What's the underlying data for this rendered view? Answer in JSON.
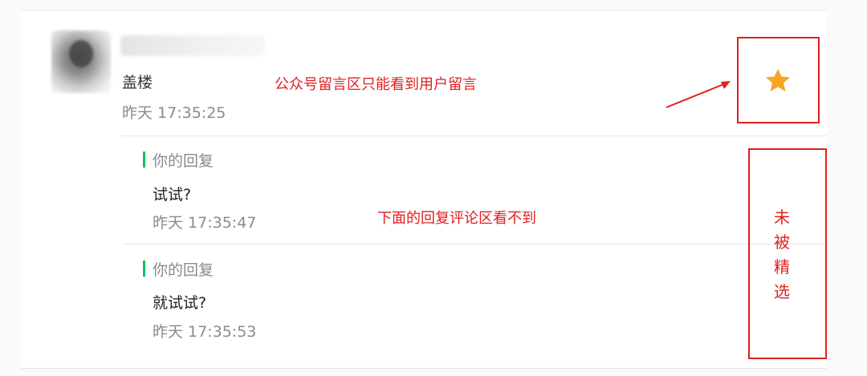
{
  "comment": {
    "text": "盖楼",
    "time": "昨天 17:35:25"
  },
  "replies": [
    {
      "label": "你的回复",
      "text": "试试?",
      "time": "昨天 17:35:47"
    },
    {
      "label": "你的回复",
      "text": "就试试?",
      "time": "昨天 17:35:53"
    }
  ],
  "annotations": {
    "top_note": "公众号留言区只能看到用户留言",
    "middle_note": "下面的回复评论区看不到",
    "side_note_chars": [
      "未",
      "被",
      "精",
      "选"
    ]
  },
  "colors": {
    "annotation_red": "#e02020",
    "star": "#f5a623",
    "reply_bar": "#07c160"
  },
  "icons": {
    "feature": "star-icon",
    "pointer": "arrow-icon"
  }
}
